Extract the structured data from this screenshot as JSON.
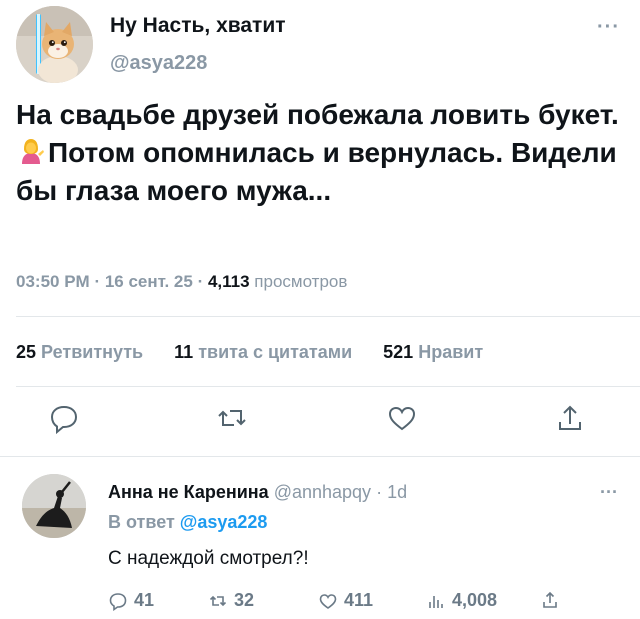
{
  "tweet": {
    "author_name": "Ну Насть, хватит",
    "author_handle": "@asya228",
    "more": "···",
    "text_part1": "На свадьбе друзей побежала ловить букет.",
    "emoji": "woman-tipping-hand-emoji",
    "text_part2": "Потом опомнилась и вернулась. Видели бы глаза моего мужа...",
    "time": "03:50 PM",
    "date": "16 сент. 25",
    "views_count": "4,113",
    "views_label": "просмотров",
    "retweets_count": "25",
    "retweets_label": "Ретвитнуть",
    "quotes_count": "11",
    "quotes_label": "твита с цитатами",
    "likes_count": "521",
    "likes_label": "Нравит"
  },
  "reply": {
    "author_name": "Анна не Каренина",
    "author_handle": "@annhapqy",
    "age": "1d",
    "more": "···",
    "reply_to_label": "В ответ",
    "reply_to_handle": "@asya228",
    "text": "С надеждой смотрел?!",
    "replies": "41",
    "retweets": "32",
    "likes": "411",
    "views": "4,008"
  },
  "colors": {
    "text": "#0f1419",
    "muted": "#8a98a5",
    "accent": "#1d9bf0",
    "divider": "#e3e7ea"
  }
}
